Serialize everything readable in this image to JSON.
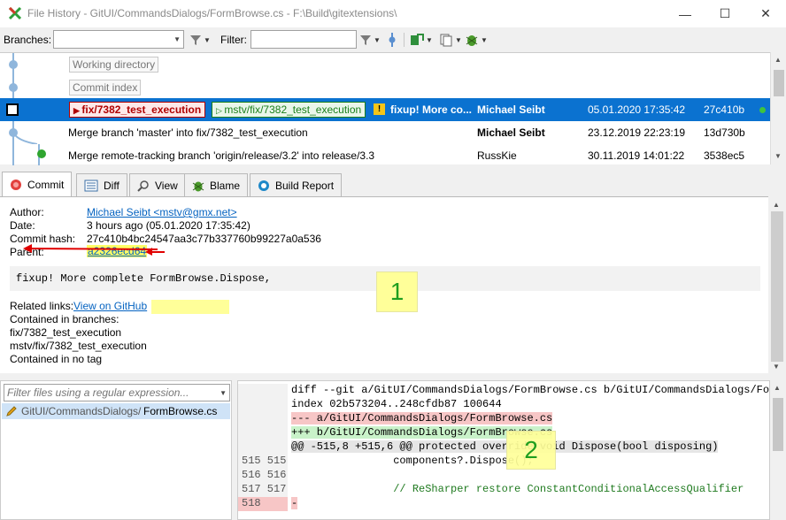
{
  "window": {
    "title": "File History - GitUI/CommandsDialogs/FormBrowse.cs - F:\\Build\\gitextensions\\",
    "controls": [
      "—",
      "☐",
      "✕"
    ]
  },
  "toolbar": {
    "branches_label": "Branches:",
    "branches_value": "",
    "filter_label": "Filter:",
    "filter_value": ""
  },
  "graph": {
    "working_directory": "Working directory",
    "commit_index": "Commit index",
    "selected": {
      "branch_label": "fix/7382_test_execution",
      "remote_label": "mstv/fix/7382_test_execution",
      "message": "fixup! More co...",
      "author": "Michael Seibt",
      "date": "05.01.2020 17:35:42",
      "hash": "27c410b"
    },
    "rows": [
      {
        "message": "Merge branch 'master' into fix/7382_test_execution",
        "author": "Michael Seibt",
        "date": "23.12.2019 22:23:19",
        "hash": "13d730b"
      },
      {
        "message": "Merge remote-tracking branch 'origin/release/3.2' into release/3.3",
        "author": "RussKie",
        "date": "30.11.2019 14:01:22",
        "hash": "3538ec5"
      }
    ]
  },
  "tabs": [
    {
      "label": "Commit",
      "icon": "commit-icon"
    },
    {
      "label": "Diff",
      "icon": "diff-icon"
    },
    {
      "label": "View",
      "icon": "magnifier-icon"
    },
    {
      "label": "Blame",
      "icon": "bug-icon"
    },
    {
      "label": "Build Report",
      "icon": "build-icon"
    }
  ],
  "commit": {
    "author_label": "Author:",
    "author_value": "Michael Seibt <mstv@gmx.net>",
    "date_label": "Date:",
    "date_value": "3 hours ago (05.01.2020 17:35:42)",
    "hash_label": "Commit hash:",
    "hash_value": "27c410b4bc24547aa3c77b337760b99227a0a536",
    "parent_label": "Parent:",
    "parent_value": "a2326ecd64",
    "message": "fixup! More complete FormBrowse.Dispose,",
    "related_label": "Related links:",
    "related_link": "View on GitHub",
    "contained_label": "Contained in branches:",
    "branch_1": "fix/7382_test_execution",
    "branch_2": "mstv/fix/7382_test_execution",
    "no_tag": "Contained in no tag",
    "marker_1": "1",
    "marker_2": "2"
  },
  "files": {
    "filter_placeholder": "Filter files using a regular expression...",
    "items": [
      {
        "path": "GitUI/CommandsDialogs/",
        "name": "FormBrowse.cs"
      }
    ]
  },
  "diff": {
    "lines": [
      {
        "ln": "",
        "text": "diff --git a/GitUI/CommandsDialogs/FormBrowse.cs b/GitUI/CommandsDialogs/Form",
        "kind": "header"
      },
      {
        "ln": "",
        "text": "index 02b573204..248cfdb87 100644",
        "kind": "header"
      },
      {
        "ln": "",
        "text": "--- a/GitUI/CommandsDialogs/FormBrowse.cs",
        "kind": "minus"
      },
      {
        "ln": "",
        "text": "+++ b/GitUI/CommandsDialogs/FormBrowse.cs",
        "kind": "plus"
      },
      {
        "ln": "",
        "text": "@@ -515,8 +515,6 @@ protected override void Dispose(bool disposing)",
        "kind": "hunk"
      },
      {
        "ln": "515 515",
        "text": "                components?.Dispose();",
        "kind": "ctx"
      },
      {
        "ln": "516 516",
        "text": "",
        "kind": "ctx"
      },
      {
        "ln": "517 517",
        "text": "                // ReSharper restore ConstantConditionalAccessQualifier",
        "kind": "comment"
      },
      {
        "ln": "518",
        "text": "-",
        "kind": "del"
      }
    ]
  },
  "colors": {
    "selection": "#0b72d0",
    "branch_red": "#b00000",
    "remote_green": "#1a7f1a",
    "highlight_yellow": "#ffff99",
    "arrow_red": "#e00000"
  }
}
